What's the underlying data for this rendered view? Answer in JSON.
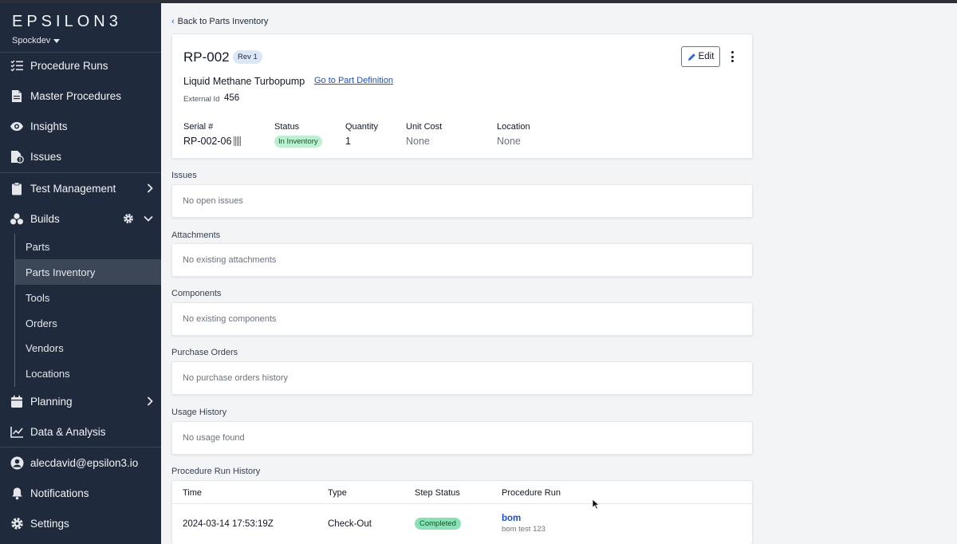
{
  "sidebar": {
    "logo": "EPSILON3",
    "workspace": "Spockdev",
    "nav": {
      "procedure_runs": "Procedure Runs",
      "master_procedures": "Master Procedures",
      "insights": "Insights",
      "issues": "Issues",
      "test_management": "Test Management",
      "builds": "Builds",
      "planning": "Planning",
      "data_analysis": "Data & Analysis",
      "user": "alecdavid@epsilon3.io",
      "notifications": "Notifications",
      "settings": "Settings"
    },
    "builds_sub": [
      "Parts",
      "Parts Inventory",
      "Tools",
      "Orders",
      "Vendors",
      "Locations"
    ],
    "active_sub": "Parts Inventory"
  },
  "main": {
    "back_label": "Back to Parts Inventory",
    "part": {
      "id": "RP-002",
      "rev": "Rev 1",
      "name": "Liquid Methane Turbopump",
      "definition_link": "Go to Part Definition",
      "external_id_label": "External Id",
      "external_id": "456",
      "edit_label": "Edit"
    },
    "fields": {
      "serial_label": "Serial #",
      "serial": "RP-002-06",
      "status_label": "Status",
      "status": "In Inventory",
      "quantity_label": "Quantity",
      "quantity": "1",
      "unit_cost_label": "Unit Cost",
      "unit_cost": "None",
      "location_label": "Location",
      "location": "None"
    },
    "sections": {
      "issues": {
        "label": "Issues",
        "empty": "No open issues"
      },
      "attachments": {
        "label": "Attachments",
        "empty": "No existing attachments"
      },
      "components": {
        "label": "Components",
        "empty": "No existing components"
      },
      "purchase_orders": {
        "label": "Purchase Orders",
        "empty": "No purchase orders history"
      },
      "usage_history": {
        "label": "Usage History",
        "empty": "No usage found"
      }
    },
    "run_history": {
      "label": "Procedure Run History",
      "columns": [
        "Time",
        "Type",
        "Step Status",
        "Procedure Run"
      ],
      "rows": [
        {
          "time": "2024-03-14 17:53:19Z",
          "type": "Check-Out",
          "step_status": "Completed",
          "run": "bom",
          "run_sub": "bom test 123"
        }
      ]
    }
  },
  "colors": {
    "sidebar": "#1f2a3c",
    "link": "#1d4ed8",
    "status_green": "#bbf0d1",
    "completed_green": "#86e3b3"
  }
}
